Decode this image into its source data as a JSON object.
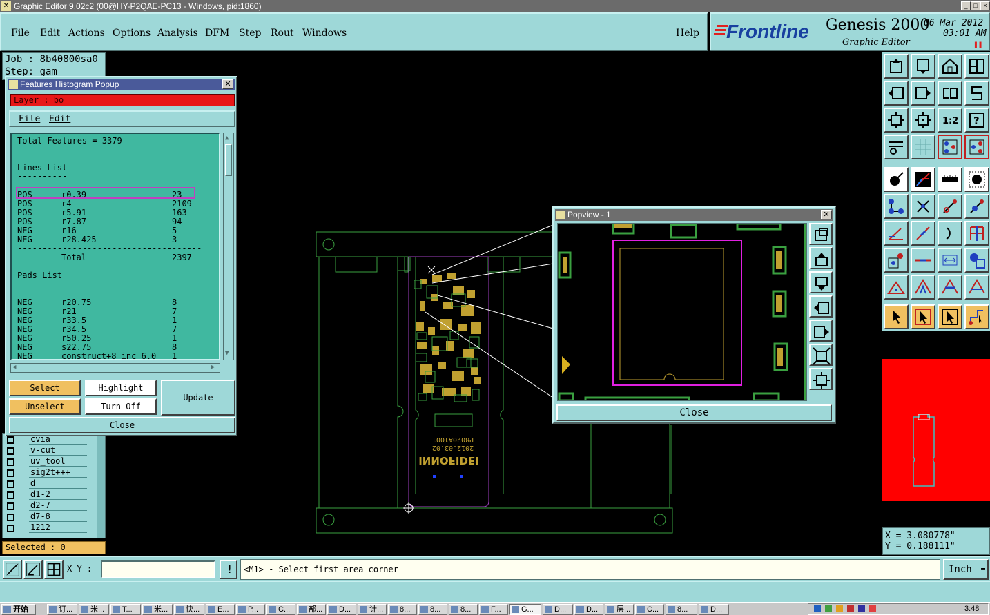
{
  "window": {
    "title": "Graphic Editor 9.02c2 (00@HY-P2QAE-PC13 - Windows, pid:1860)"
  },
  "menubar": {
    "items": [
      "File",
      "Edit",
      "Actions",
      "Options",
      "Analysis",
      "DFM",
      "Step",
      "Rout",
      "Windows"
    ],
    "help": "Help"
  },
  "brand": {
    "logo": "Frontline",
    "product": "Genesis 2000",
    "subtitle": "Graphic Editor",
    "date": "06 Mar 2012",
    "time": "03:01 AM"
  },
  "job": {
    "label": "Job : 8b40800sa0",
    "step": "Step: gam"
  },
  "histogram": {
    "title": "Features Histogram Popup",
    "layer": "Layer :  bo",
    "menu": [
      "File",
      "Edit"
    ],
    "total": "Total Features = 3379",
    "lines_heading": "Lines List",
    "pads_heading": "Pads List",
    "underline": "----------",
    "lines": [
      {
        "pol": "POS",
        "sym": "r0.39",
        "count": "23"
      },
      {
        "pol": "POS",
        "sym": "r4",
        "count": "2109"
      },
      {
        "pol": "POS",
        "sym": "r5.91",
        "count": "163"
      },
      {
        "pol": "POS",
        "sym": "r7.87",
        "count": "94"
      },
      {
        "pol": "NEG",
        "sym": "r16",
        "count": "5"
      },
      {
        "pol": "NEG",
        "sym": "r28.425",
        "count": "3"
      }
    ],
    "separator": "--------------------------------------",
    "lines_total_label": "Total",
    "lines_total": "2397",
    "pads": [
      {
        "pol": "NEG",
        "sym": "r20.75",
        "count": "8"
      },
      {
        "pol": "NEG",
        "sym": "r21",
        "count": "7"
      },
      {
        "pol": "NEG",
        "sym": "r33.5",
        "count": "1"
      },
      {
        "pol": "NEG",
        "sym": "r34.5",
        "count": "7"
      },
      {
        "pol": "NEG",
        "sym": "r50.25",
        "count": "1"
      },
      {
        "pol": "NEG",
        "sym": "s22.75",
        "count": "8"
      },
      {
        "pol": "NEG",
        "sym": "construct+8_inc_6.0",
        "count": "1"
      }
    ],
    "buttons": {
      "select": "Select",
      "highlight": "Highlight",
      "update": "Update",
      "unselect": "Unselect",
      "turn_off": "Turn Off",
      "close": "Close"
    }
  },
  "layers": [
    "cvia",
    "v-cut",
    "uv_tool",
    "sig2t+++",
    "d",
    "d1-2",
    "d2-7",
    "d7-8",
    "1212"
  ],
  "selected": "Selected : 0",
  "popview": {
    "title": "Popview - 1",
    "close": "Close"
  },
  "board_text": {
    "line1": "P8020A1001",
    "line2": "2012.03.02",
    "logo": "INNOFIDEI"
  },
  "coords": {
    "x": "X = 3.080778\"",
    "y": "Y = 0.188111\""
  },
  "bottom": {
    "xy_label": "X Y :",
    "xy_value": "",
    "prompt": "<M1> - Select first area corner",
    "units": "Inch"
  },
  "taskbar": {
    "start": "开始",
    "items": [
      "订...",
      "米...",
      "T...",
      "米...",
      "快...",
      "E...",
      "P...",
      "C...",
      "部...",
      "D...",
      "计...",
      "8...",
      "8...",
      "8...",
      "F...",
      "G...",
      "D...",
      "D...",
      "层...",
      "C...",
      "8...",
      "D..."
    ],
    "clock": "3:48"
  },
  "colors": {
    "panel": "#9ed8d8",
    "list_bg": "#40b8a0",
    "layer_red": "#e81818",
    "accent_orange": "#f0c060",
    "highlight_magenta": "#c040c0"
  }
}
